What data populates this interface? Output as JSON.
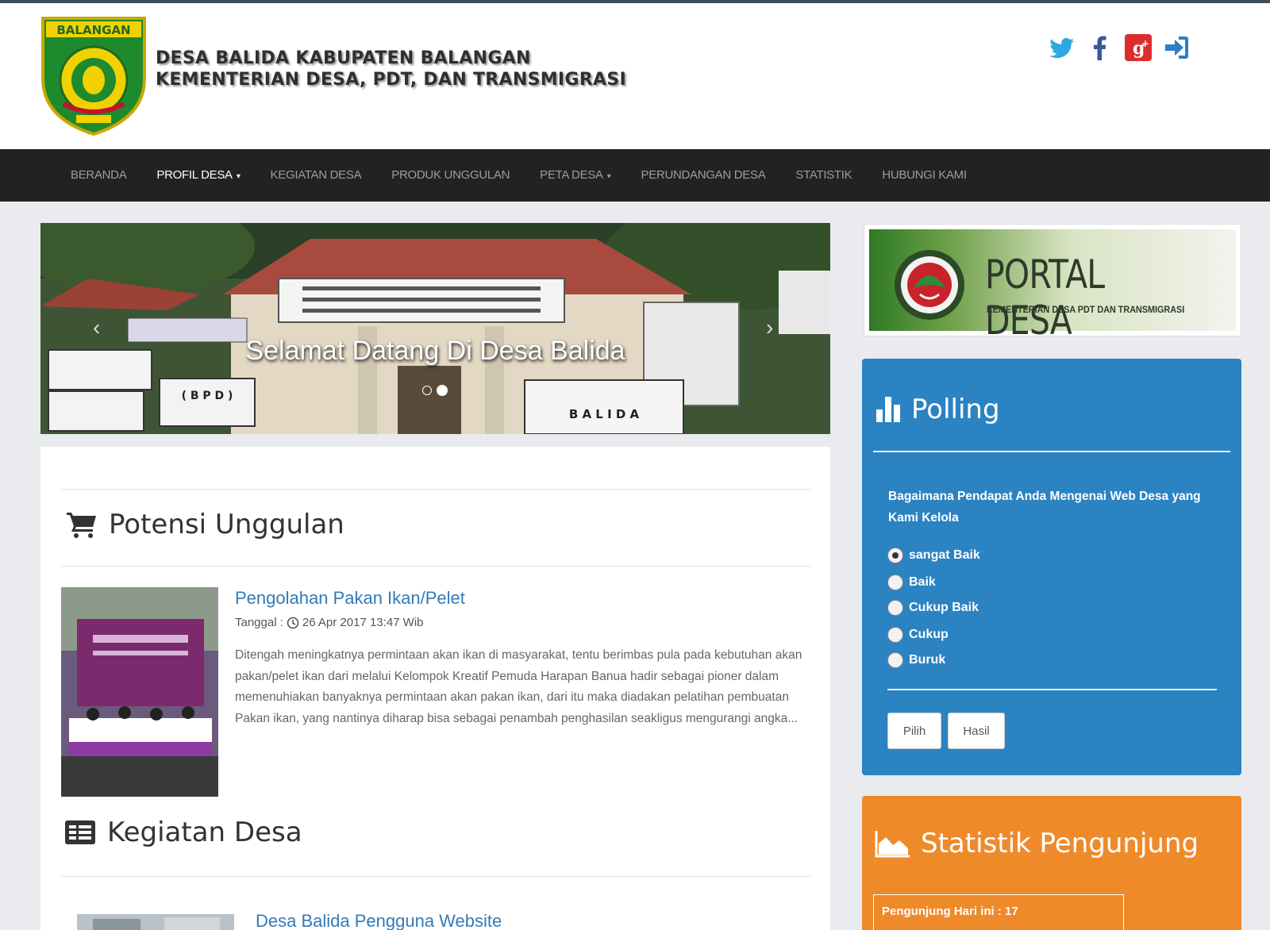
{
  "header": {
    "logo_text": "BALANGAN",
    "title_line1": "DESA BALIDA KABUPATEN BALANGAN",
    "title_line2": "KEMENTERIAN DESA, PDT, DAN TRANSMIGRASI",
    "social": [
      "twitter-icon",
      "facebook-icon",
      "google-plus-icon",
      "login-icon"
    ]
  },
  "nav": {
    "items": [
      {
        "label": "BERANDA"
      },
      {
        "label": "PROFIL DESA",
        "caret": "▾"
      },
      {
        "label": "KEGIATAN DESA"
      },
      {
        "label": "PRODUK UNGGULAN"
      },
      {
        "label": "PETA DESA",
        "caret": "▾"
      },
      {
        "label": "PERUNDANGAN DESA"
      },
      {
        "label": "STATISTIK"
      },
      {
        "label": "HUBUNGI KAMI"
      }
    ]
  },
  "slider": {
    "caption": "Selamat Datang Di Desa Balida",
    "prev": "‹",
    "next": "›",
    "sign_bpd": "( B P D )",
    "sign_balida": "B A L I D A"
  },
  "potensi": {
    "title": "Potensi Unggulan",
    "post": {
      "title": "Pengolahan Pakan Ikan/Pelet",
      "date_label": "Tanggal :",
      "date": "26 Apr 2017 13:47 Wib",
      "excerpt": "Ditengah meningkatnya permintaan akan ikan di masyarakat, tentu berimbas pula pada kebutuhan akan pakan/pelet ikan dari melalui Kelompok Kreatif Pemuda Harapan Banua hadir sebagai pioner dalam memenuhiakan banyaknya permintaan akan pakan ikan, dari itu maka  diadakan pelatihan pembuatan Pakan ikan, yang nantinya diharap bisa sebagai penambah penghasilan seakligus mengurangi angka..."
    }
  },
  "kegiatan": {
    "title": "Kegiatan Desa",
    "post": {
      "title": "Desa Balida Pengguna Website"
    }
  },
  "portal": {
    "title": "PORTAL DESA",
    "subtitle": "KEMENTERIAN DESA PDT DAN TRANSMIGRASI"
  },
  "polling": {
    "title": "Polling",
    "question": "Bagaimana Pendapat Anda Mengenai Web Desa yang Kami Kelola",
    "options": [
      {
        "label": "sangat Baik",
        "checked": true
      },
      {
        "label": "Baik",
        "checked": false
      },
      {
        "label": "Cukup Baik",
        "checked": false
      },
      {
        "label": "Cukup",
        "checked": false
      },
      {
        "label": "Buruk",
        "checked": false
      }
    ],
    "btn_pilih": "Pilih",
    "btn_hasil": "Hasil"
  },
  "statistik": {
    "title": "Statistik Pengunjung",
    "today": "Pengunjung Hari ini : 17"
  },
  "colors": {
    "navbar": "#222222",
    "polling_bg": "#2b83c2",
    "statistik_bg": "#ef8a2b",
    "link": "#337ab7"
  }
}
